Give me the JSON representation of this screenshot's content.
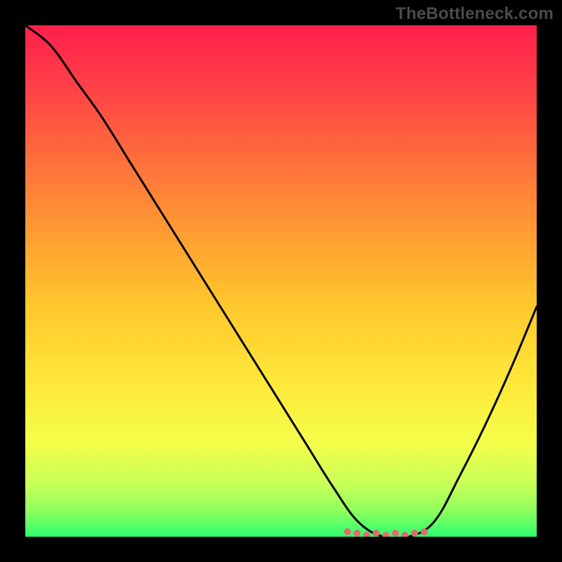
{
  "attribution": "TheBottleneck.com",
  "colors": {
    "gradient_top": "#ff1f4b",
    "gradient_mid": "#ffe03a",
    "gradient_bottom": "#2cff6f",
    "curve": "#000000",
    "dots": "#e26b6b",
    "frame": "#000000"
  },
  "chart_data": {
    "type": "line",
    "title": "",
    "xlabel": "",
    "ylabel": "",
    "xlim": [
      0,
      100
    ],
    "ylim": [
      0,
      100
    ],
    "x": [
      0,
      5,
      10,
      15,
      20,
      25,
      30,
      35,
      40,
      45,
      50,
      55,
      60,
      65,
      70,
      75,
      80,
      85,
      90,
      95,
      100
    ],
    "values": [
      100,
      96,
      89,
      82,
      74,
      66,
      58,
      50,
      42,
      34,
      26,
      18,
      10,
      3,
      0,
      0,
      3,
      12,
      22,
      33,
      45
    ],
    "min_plateau": {
      "x_start": 63,
      "x_end": 78,
      "value": 0
    },
    "dot_cluster": {
      "x_start": 63,
      "x_end": 78,
      "count": 9
    }
  }
}
